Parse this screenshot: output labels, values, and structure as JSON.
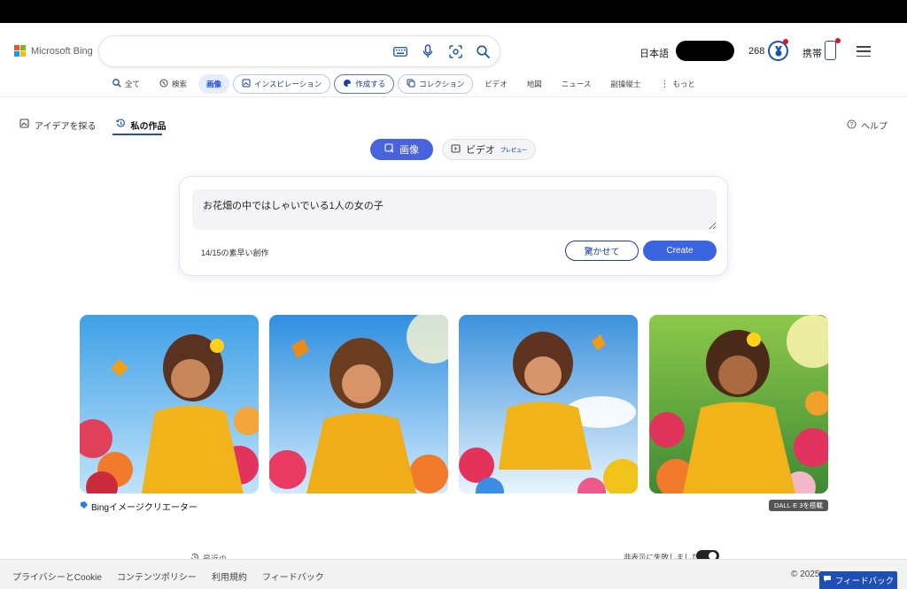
{
  "header": {
    "logo_text": "Microsoft Bing",
    "language": "日本語",
    "points": "268",
    "mobile_label": "携帯",
    "search": {
      "placeholder": "",
      "value": ""
    }
  },
  "nav": {
    "items": [
      {
        "label": "全て",
        "icon": "search-icon"
      },
      {
        "label": "検索",
        "icon": "copilot-icon"
      },
      {
        "label": "画像",
        "icon": ""
      },
      {
        "label": "インスピレーション",
        "icon": "inspiration-icon"
      },
      {
        "label": "作成する",
        "icon": "palette-icon"
      },
      {
        "label": "コレクション",
        "icon": "collection-icon"
      },
      {
        "label": "ビデオ",
        "icon": ""
      },
      {
        "label": "地図",
        "icon": ""
      },
      {
        "label": "ニュース",
        "icon": ""
      },
      {
        "label": "副操縦士",
        "icon": ""
      },
      {
        "label": "もっと",
        "icon": "more-dots-icon"
      }
    ]
  },
  "subnav": {
    "explore": "アイデアを探る",
    "my_creations": "私の作品",
    "help": "ヘルプ"
  },
  "mode": {
    "image": "画像",
    "video": "ビデオ",
    "preview": "プレビュー"
  },
  "prompt": {
    "value": "お花畑の中ではしゃいでいる1人の女の子",
    "boosts": "14/15の素早い創作",
    "surprise_label": "驚かせて",
    "create_label": "Create"
  },
  "results": {
    "creator_label": "Bingイメージクリエーター",
    "dalle_label": "DALL·E 3を搭載",
    "recent_label": "最近の",
    "hide_failed_label": "非表示に失敗しました"
  },
  "footer": {
    "links": [
      "プライバシーとCookie",
      "コンテンツポリシー",
      "利用規約",
      "フィードバック"
    ],
    "copyright": "© 2025",
    "feedback_button": "フィードバック"
  },
  "colors": {
    "accent": "#3a64e0",
    "nav_active_bg": "#e5ecfb",
    "dress": "#f0b31a"
  }
}
